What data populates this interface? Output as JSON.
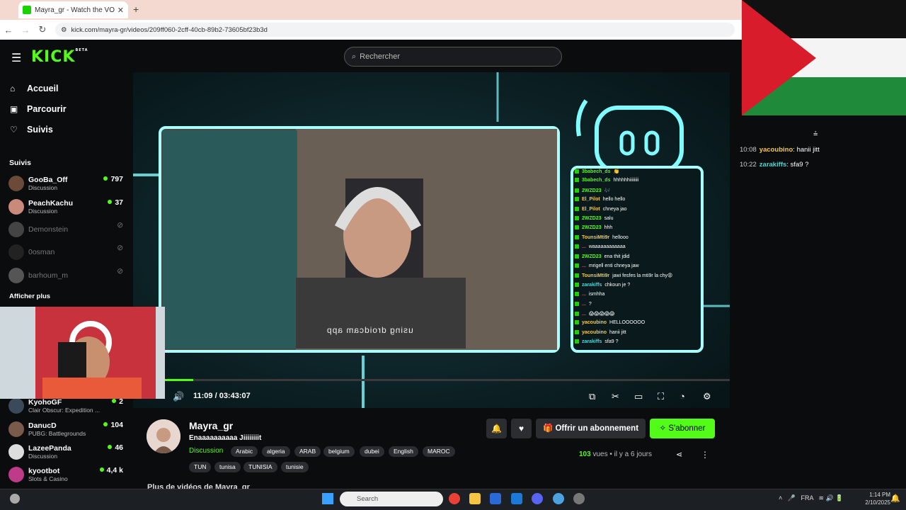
{
  "browser": {
    "tab_title": "Mayra_gr - Watch the VOD on K",
    "tab_close": "✕",
    "new_tab": "+",
    "url": "kick.com/mayra-gr/videos/209ff060-2cff-40cb-89b2-73605bf23b3d"
  },
  "header": {
    "logo": "KICK",
    "logo_beta": "BETA",
    "search_placeholder": "Rechercher"
  },
  "sidebar": {
    "nav": [
      {
        "label": "Accueil",
        "icon": "home-icon"
      },
      {
        "label": "Parcourir",
        "icon": "browse-icon"
      },
      {
        "label": "Suivis",
        "icon": "heart-icon"
      }
    ],
    "following_heading": "Suivis",
    "following": [
      {
        "name": "GooBa_Off",
        "category": "Discussion",
        "viewers": "797",
        "live": true
      },
      {
        "name": "PeachKachu",
        "category": "Discussion",
        "viewers": "37",
        "live": true
      },
      {
        "name": "Demonstein",
        "category": "",
        "viewers": "",
        "live": false
      },
      {
        "name": "0osman",
        "category": "",
        "viewers": "",
        "live": false
      },
      {
        "name": "barhoum_m",
        "category": "",
        "viewers": "",
        "live": false
      }
    ],
    "show_more": "Afficher plus",
    "following_bottom": [
      {
        "name": "KyohoGF",
        "category": "Clair Obscur: Expedition ...",
        "viewers": "2"
      },
      {
        "name": "DanucD",
        "category": "PUBG: Battlegrounds",
        "viewers": "104"
      },
      {
        "name": "LazeePanda",
        "category": "Discussion",
        "viewers": "46"
      },
      {
        "name": "kyootbot",
        "category": "Slots & Casino",
        "viewers": "4,4 k"
      }
    ]
  },
  "player": {
    "time": "11:09 / 03:43:07",
    "progress": 0.05,
    "overlay_text": "using droidcam app",
    "chat_overlay": [
      {
        "user": "3babech_ds",
        "msg": "👏",
        "color": "#53fc18"
      },
      {
        "user": "3babech_ds",
        "msg": "hhhhhhiiiiiiii",
        "color": "#53fc18"
      },
      {
        "user": "2WZD23",
        "msg": "🎶",
        "color": "#53fc18"
      },
      {
        "user": "El_Pilot",
        "msg": "hello hello",
        "color": "#f5c842"
      },
      {
        "user": "El_Pilot",
        "msg": "chneya jao",
        "color": "#f5c842"
      },
      {
        "user": "2WZD23",
        "msg": "salu",
        "color": "#53fc18"
      },
      {
        "user": "2WZD23",
        "msg": "hhh",
        "color": "#53fc18"
      },
      {
        "user": "TounsiMti9r",
        "msg": "hellooo",
        "color": "#f5c842"
      },
      {
        "user": "...",
        "msg": "waaaaaaaaaaaa",
        "color": "#e84b6a"
      },
      {
        "user": "2WZD23",
        "msg": "ena thit jdid",
        "color": "#53fc18"
      },
      {
        "user": "...",
        "msg": "mrigell enti chneya jaw",
        "color": "#e84b6a"
      },
      {
        "user": "TounsiMti9r",
        "msg": "jawi fesfes la mti9r la chy😡",
        "color": "#f5c842"
      },
      {
        "user": "zarakiffs",
        "msg": "chkoun je ?",
        "color": "#4ad6d6"
      },
      {
        "user": "...",
        "msg": "ismhha",
        "color": "#e84b6a"
      },
      {
        "user": "...",
        "msg": "?",
        "color": "#e84b6a"
      },
      {
        "user": "...",
        "msg": "😱😱😱😱😱",
        "color": "#e84b6a"
      },
      {
        "user": "yacoubino",
        "msg": "HELLOOOOOO",
        "color": "#f5c842"
      },
      {
        "user": "yacoubino",
        "msg": "hanii jitt",
        "color": "#f5c842"
      },
      {
        "user": "zarakiffs",
        "msg": "sfa9 ?",
        "color": "#4ad6d6"
      }
    ]
  },
  "channel": {
    "name": "Mayra_gr",
    "title": "Enaaaaaaaaaa Jiiiiiiiit",
    "category": "Discussion",
    "tags_row1": [
      "Arabic",
      "algeria",
      "ARAB",
      "belgium",
      "dubei",
      "English",
      "MAROC"
    ],
    "tags_row2": [
      "TUN",
      "tunisa",
      "TUNISIA",
      "tunisie"
    ],
    "gift_label": "Offrir un abonnement",
    "subscribe_label": "S'abonner",
    "views_count": "103",
    "views_text": "vues • il y a 6 jours",
    "more_videos": "Plus de vidéos de Mayra_gr"
  },
  "chat": [
    {
      "time": "10:08",
      "user": "yacoubino",
      "msg": "hanii jitt",
      "color": "#f5c842"
    },
    {
      "time": "10:22",
      "user": "zarakiffs",
      "msg": "sfa9 ?",
      "color": "#4ad6d6"
    }
  ],
  "taskbar": {
    "search": "Search",
    "lang": "FRA",
    "time": "1:14 PM",
    "date": "2/10/2025"
  },
  "colors": {
    "brand": "#53fc18",
    "bg": "#0b0c0e"
  }
}
